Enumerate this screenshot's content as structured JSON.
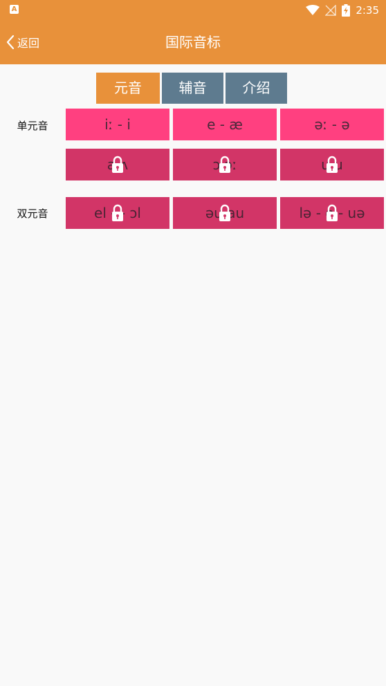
{
  "status_bar": {
    "app_icon_letter": "A",
    "time": "2:35"
  },
  "nav": {
    "back_label": "返回",
    "title": "国际音标"
  },
  "tabs": [
    {
      "label": "元音",
      "active": true
    },
    {
      "label": "辅音",
      "active": false
    },
    {
      "label": "介绍",
      "active": false
    }
  ],
  "sections": {
    "monophthongs_label": "单元音",
    "diphthongs_label": "双元音"
  },
  "cells": {
    "r1c1": "iː - i",
    "r1c2": "e - æ",
    "r1c3": "əː - ə",
    "r2c1": "a  ʌ",
    "r2c2": "ɔ  ɔː",
    "r2c3": "u  u",
    "r3c1": "el -   - ɔl",
    "r3c2": "əu  au",
    "r3c3": "lə - e  - uə"
  },
  "colors": {
    "accent": "#e8913a",
    "tab_inactive": "#5e7b8f",
    "cell_open": "#ff4080",
    "cell_locked": "#d23567"
  }
}
